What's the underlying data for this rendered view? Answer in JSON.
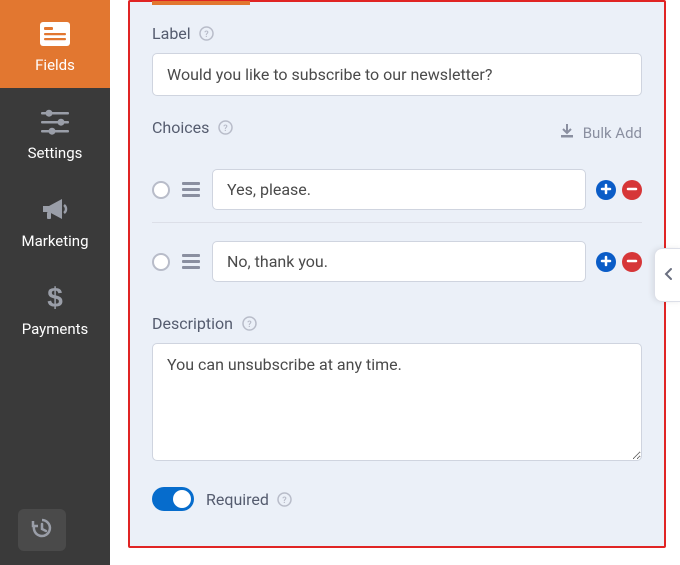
{
  "sidebar": {
    "items": [
      {
        "label": "Fields",
        "icon": "form-fields-icon"
      },
      {
        "label": "Settings",
        "icon": "sliders-icon"
      },
      {
        "label": "Marketing",
        "icon": "bullhorn-icon"
      },
      {
        "label": "Payments",
        "icon": "dollar-icon"
      }
    ]
  },
  "panel": {
    "label_section": {
      "title": "Label",
      "value": "Would you like to subscribe to our newsletter?"
    },
    "choices_section": {
      "title": "Choices",
      "bulk_add_label": "Bulk Add",
      "items": [
        {
          "value": "Yes, please."
        },
        {
          "value": "No, thank you."
        }
      ]
    },
    "description_section": {
      "title": "Description",
      "value": "You can unsubscribe at any time."
    },
    "required_label": "Required"
  }
}
